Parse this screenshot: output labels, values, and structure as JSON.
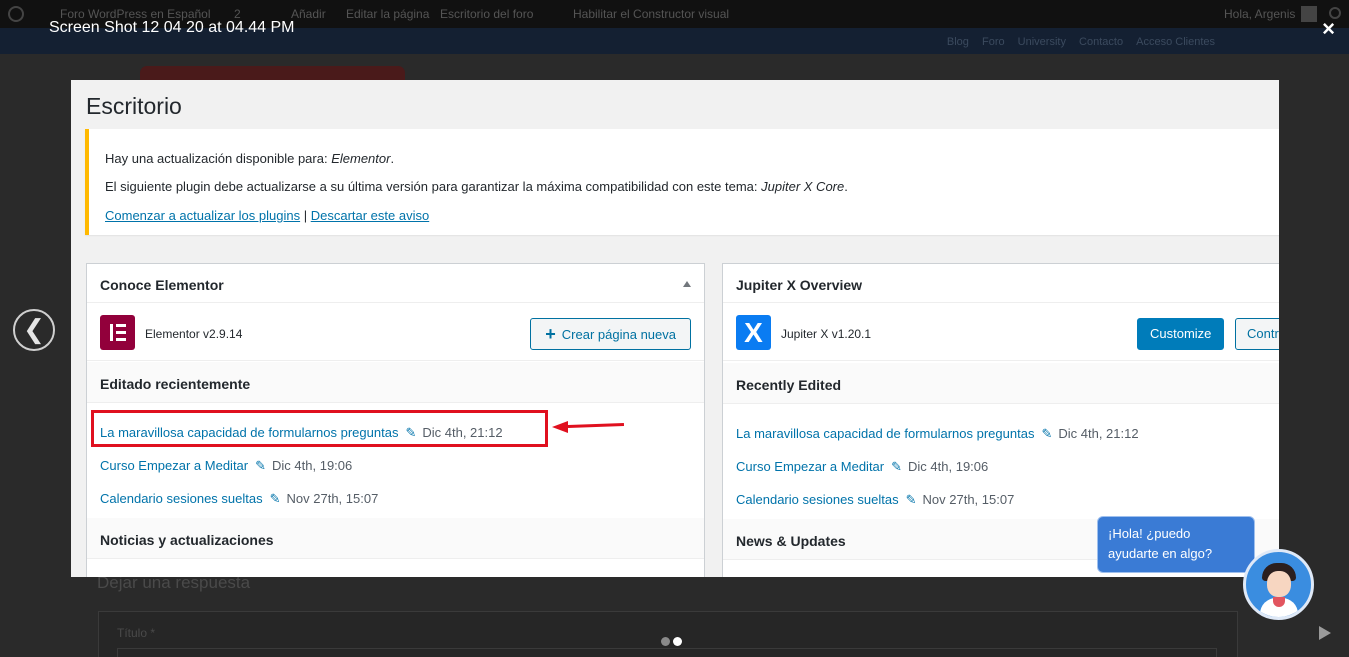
{
  "background": {
    "adminbar": [
      "Foro WordPress en Español",
      "2",
      "Añadir",
      "Editar la página",
      "Escritorio del foro",
      "Habilitar el Constructor visual",
      "Hola, Argenis"
    ],
    "nav": [
      "Blog",
      "Foro",
      "University",
      "Contacto",
      "Acceso Clientes"
    ],
    "reply_title": "Dejar una respuesta",
    "form_label": "Título *"
  },
  "lightbox": {
    "title": "Screen Shot 12 04 20 at 04.44 PM",
    "close": "×",
    "prev": "❮"
  },
  "screenshot": {
    "page_title": "Escritorio",
    "notice": {
      "line1_prefix": "Hay una actualización disponible para: ",
      "line1_plugin": "Elementor",
      "line1_suffix": ".",
      "line2_prefix": "El siguiente plugin debe actualizarse a su última versión para garantizar la máxima compatibilidad con este tema: ",
      "line2_plugin": "Jupiter X Core",
      "line2_suffix": ".",
      "link_update": "Comenzar a actualizar los plugins",
      "separator": " | ",
      "link_dismiss": "Descartar este aviso"
    },
    "elementor_box": {
      "title": "Conoce Elementor",
      "version": "Elementor v2.9.14",
      "create_button": "Crear página nueva",
      "recent_title": "Editado recientemente",
      "news_title": "Noticias y actualizaciones",
      "recent": [
        {
          "title": "La maravillosa capacidad de formularnos preguntas",
          "date": "Dic 4th, 21:12"
        },
        {
          "title": "Curso Empezar a Meditar",
          "date": "Dic 4th, 19:06"
        },
        {
          "title": "Calendario sesiones sueltas",
          "date": "Nov 27th, 15:07"
        }
      ]
    },
    "jupiter_box": {
      "title": "Jupiter X Overview",
      "version": "Jupiter X v1.20.1",
      "customize_button": "Customize",
      "control_button": "Control Panel",
      "recent_title": "Recently Edited",
      "news_title": "News & Updates",
      "recent": [
        {
          "title": "La maravillosa capacidad de formularnos preguntas",
          "date": "Dic 4th, 21:12"
        },
        {
          "title": "Curso Empezar a Meditar",
          "date": "Dic 4th, 19:06"
        },
        {
          "title": "Calendario sesiones sueltas",
          "date": "Nov 27th, 15:07"
        }
      ]
    }
  },
  "chat": {
    "message": "¡Hola! ¿puedo ayudarte en algo?"
  },
  "colors": {
    "wp_link": "#0073aa",
    "wp_button": "#007cba",
    "notice_border": "#ffb900",
    "annotation_red": "#e0101f",
    "elementor_brand": "#92003b",
    "jupiter_brand": "#0a7cf2"
  }
}
